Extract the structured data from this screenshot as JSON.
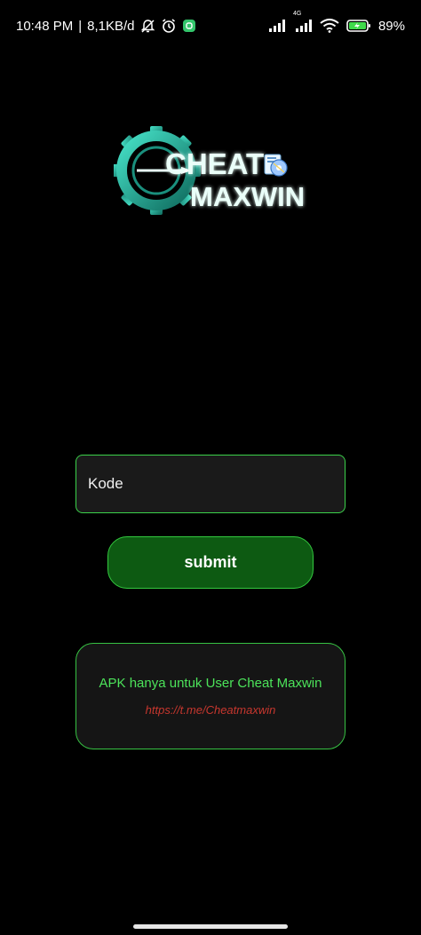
{
  "status_bar": {
    "time": "10:48 PM",
    "separator": "|",
    "speed": "8,1KB/d",
    "network_label": "4G",
    "battery": "89%"
  },
  "logo": {
    "line1": "CHEAT",
    "line2": "MAXWIN"
  },
  "form": {
    "code_placeholder": "Kode",
    "submit_label": "submit"
  },
  "info": {
    "message": "APK hanya untuk User Cheat Maxwin",
    "link": "https://t.me/Cheatmaxwin"
  },
  "colors": {
    "background": "#000000",
    "accent_green": "#3bd24a",
    "button_green": "#0d5a12",
    "link_red": "#c8372e",
    "logo_teal": "#2ec9b0"
  }
}
